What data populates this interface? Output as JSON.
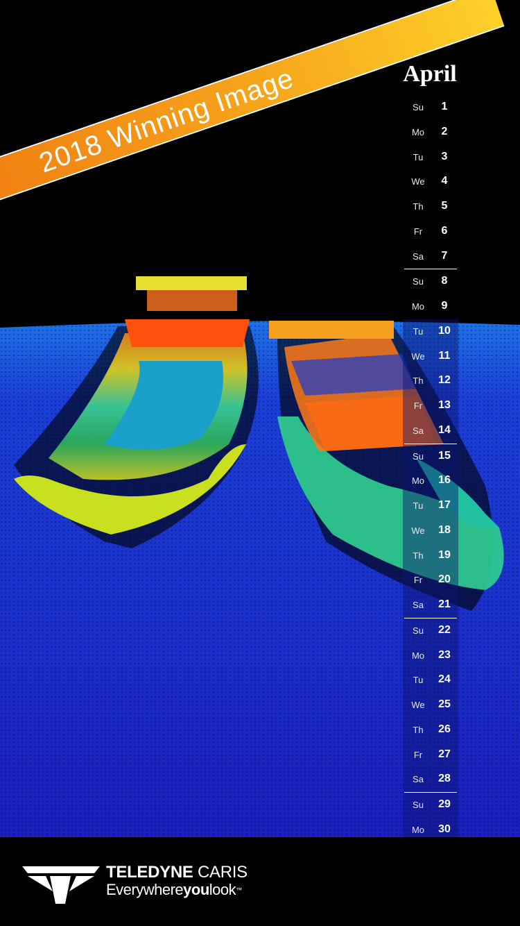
{
  "banner": {
    "text": "2018 Winning Image"
  },
  "calendar": {
    "month": "April",
    "days": [
      {
        "dow": "Su",
        "num": "1"
      },
      {
        "dow": "Mo",
        "num": "2"
      },
      {
        "dow": "Tu",
        "num": "3"
      },
      {
        "dow": "We",
        "num": "4"
      },
      {
        "dow": "Th",
        "num": "5"
      },
      {
        "dow": "Fr",
        "num": "6"
      },
      {
        "dow": "Sa",
        "num": "7"
      },
      {
        "dow": "Su",
        "num": "8"
      },
      {
        "dow": "Mo",
        "num": "9"
      },
      {
        "dow": "Tu",
        "num": "10"
      },
      {
        "dow": "We",
        "num": "11"
      },
      {
        "dow": "Th",
        "num": "12"
      },
      {
        "dow": "Fr",
        "num": "13"
      },
      {
        "dow": "Sa",
        "num": "14"
      },
      {
        "dow": "Su",
        "num": "15"
      },
      {
        "dow": "Mo",
        "num": "16"
      },
      {
        "dow": "Tu",
        "num": "17"
      },
      {
        "dow": "We",
        "num": "18"
      },
      {
        "dow": "Th",
        "num": "19"
      },
      {
        "dow": "Fr",
        "num": "20"
      },
      {
        "dow": "Sa",
        "num": "21"
      },
      {
        "dow": "Su",
        "num": "22"
      },
      {
        "dow": "Mo",
        "num": "23"
      },
      {
        "dow": "Tu",
        "num": "24"
      },
      {
        "dow": "We",
        "num": "25"
      },
      {
        "dow": "Th",
        "num": "26"
      },
      {
        "dow": "Fr",
        "num": "27"
      },
      {
        "dow": "Sa",
        "num": "28"
      },
      {
        "dow": "Su",
        "num": "29"
      },
      {
        "dow": "Mo",
        "num": "30"
      }
    ]
  },
  "footer": {
    "brand_bold": "TELEDYNE",
    "brand_rest": " CARIS",
    "tagline_a": "Everywhere",
    "tagline_b": "you",
    "tagline_c": "look",
    "trademark": "™",
    "logo_icon": "teledyne-logo-icon"
  },
  "colors": {
    "banner_start": "#f07d12",
    "banner_end": "#fdd12a",
    "seafloor": "#1a2bd0",
    "seafloor_far": "#1f6be0"
  }
}
